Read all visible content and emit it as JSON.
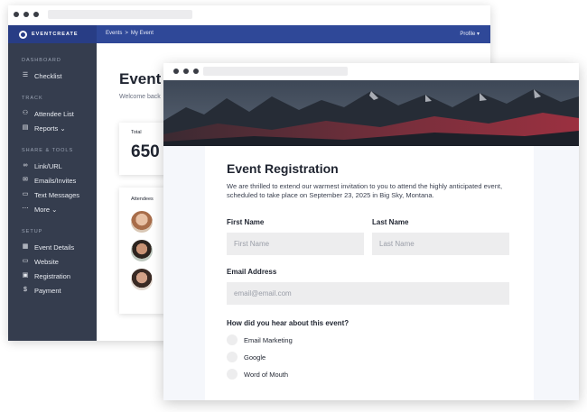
{
  "dashboard": {
    "brand": "EVENTCREATE",
    "breadcrumb": [
      "Events",
      ">",
      "My Event"
    ],
    "profile_label": "Profile ▾",
    "sidebar": {
      "sections": [
        {
          "title": "DASHBOARD",
          "items": [
            {
              "label": "Checklist",
              "icon": "checklist-icon"
            }
          ]
        },
        {
          "title": "TRACK",
          "items": [
            {
              "label": "Attendee List",
              "icon": "users-icon"
            },
            {
              "label": "Reports ⌄",
              "icon": "chart-icon"
            }
          ]
        },
        {
          "title": "SHARE & TOOLS",
          "items": [
            {
              "label": "Link/URL",
              "icon": "link-icon"
            },
            {
              "label": "Emails/Invites",
              "icon": "envelope-icon"
            },
            {
              "label": "Text Messages",
              "icon": "message-icon"
            },
            {
              "label": "More ⌄",
              "icon": "more-icon"
            }
          ]
        },
        {
          "title": "SETUP",
          "items": [
            {
              "label": "Event Details",
              "icon": "calendar-icon"
            },
            {
              "label": "Website",
              "icon": "monitor-icon"
            },
            {
              "label": "Registration",
              "icon": "clipboard-icon"
            },
            {
              "label": "Payment",
              "icon": "dollar-icon"
            }
          ]
        }
      ]
    },
    "main": {
      "title": "Event D",
      "welcome": "Welcome back",
      "total_label": "Total",
      "total_value": "650",
      "attendees_label": "Attendees"
    }
  },
  "registration": {
    "title": "Event Registration",
    "intro": "We are thrilled to extend our warmest invitation to you to attend the highly anticipated event, scheduled to take place on September 23, 2025 in Big Sky, Montana.",
    "first_name": {
      "label": "First Name",
      "placeholder": "First Name"
    },
    "last_name": {
      "label": "Last Name",
      "placeholder": "Last Name"
    },
    "email": {
      "label": "Email Address",
      "placeholder": "email@email.com"
    },
    "question": "How did you hear about this event?",
    "options": [
      "Email Marketing",
      "Google",
      "Word of Mouth"
    ]
  },
  "colors": {
    "nav": "#2f4898",
    "sidebar": "#353d4e",
    "field": "#ededee"
  }
}
